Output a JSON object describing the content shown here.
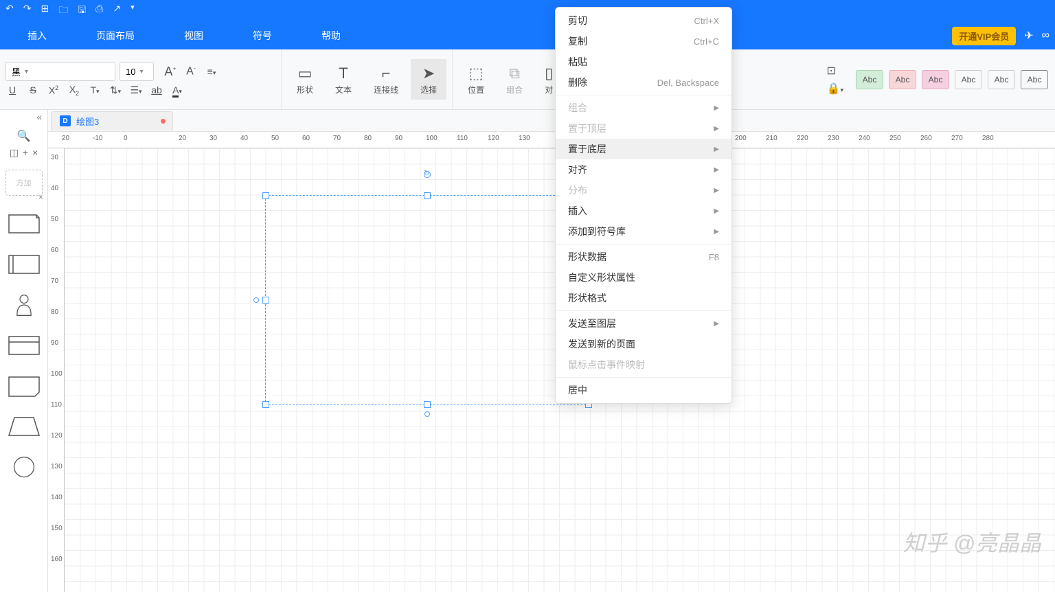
{
  "menus": {
    "insert": "插入",
    "page_layout": "页面布局",
    "view": "视图",
    "symbol": "符号",
    "help": "帮助"
  },
  "vip_label": "开通VIP会员",
  "font": {
    "name": "黑",
    "size": "10"
  },
  "tools": {
    "shape": "形状",
    "text": "文本",
    "connector": "连接线",
    "select": "选择",
    "position": "位置",
    "group": "组合",
    "align": "对"
  },
  "swatch_label": "Abc",
  "doc_tab": "绘图3",
  "sidebar": {
    "placeholder": "方加"
  },
  "ruler_h": [
    "20",
    "-10",
    "0",
    "20",
    "30",
    "40",
    "50",
    "60",
    "70",
    "80",
    "90",
    "100",
    "110",
    "120",
    "130",
    "",
    "200",
    "210",
    "220",
    "230",
    "240",
    "250",
    "260",
    "270",
    "280"
  ],
  "ruler_v": [
    "30",
    "40",
    "50",
    "60",
    "70",
    "80",
    "90",
    "100",
    "110",
    "120",
    "130",
    "140",
    "150",
    "160"
  ],
  "ctx": {
    "cut": "剪切",
    "cut_sc": "Ctrl+X",
    "copy": "复制",
    "copy_sc": "Ctrl+C",
    "paste": "粘贴",
    "delete": "删除",
    "delete_sc": "Del, Backspace",
    "group": "组合",
    "to_front": "置于顶层",
    "to_back": "置于底层",
    "align": "对齐",
    "distribute": "分布",
    "insert": "插入",
    "add_symbol": "添加到符号库",
    "shape_data": "形状数据",
    "shape_data_sc": "F8",
    "custom_shape": "自定义形状属性",
    "shape_format": "形状格式",
    "send_layer": "发送至图层",
    "send_page": "发送到新的页面",
    "click_map": "鼠标点击事件映射",
    "center": "居中"
  },
  "watermark": "知乎 @亮晶晶"
}
